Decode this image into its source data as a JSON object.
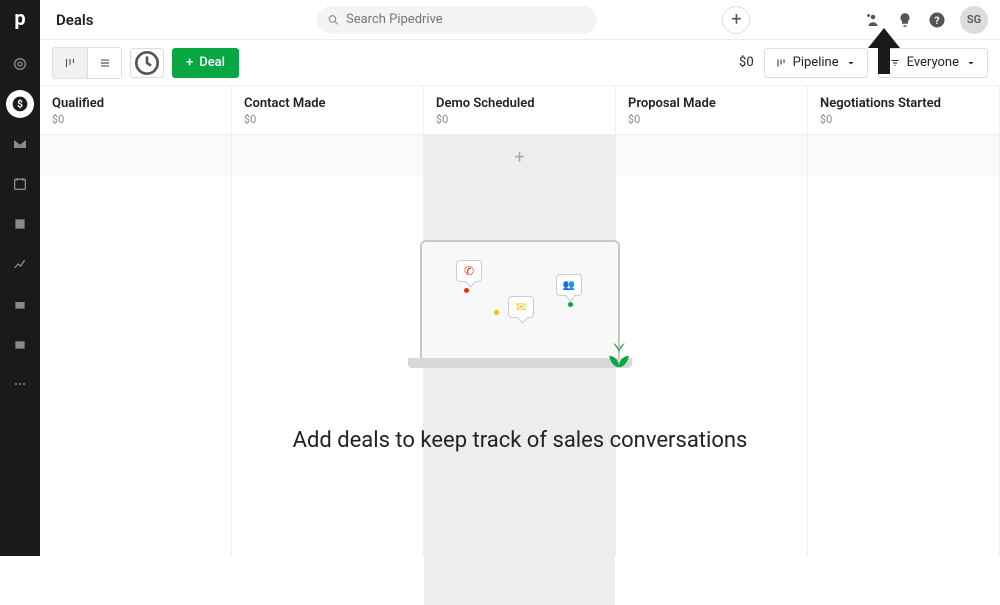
{
  "header": {
    "page_title": "Deals",
    "search_placeholder": "Search Pipedrive",
    "avatar_initials": "SG"
  },
  "toolbar": {
    "deal_button": "Deal",
    "total": "$0",
    "pipeline_label": "Pipeline",
    "everyone_label": "Everyone"
  },
  "stages": [
    {
      "name": "Qualified",
      "amount": "$0"
    },
    {
      "name": "Contact Made",
      "amount": "$0"
    },
    {
      "name": "Demo Scheduled",
      "amount": "$0"
    },
    {
      "name": "Proposal Made",
      "amount": "$0"
    },
    {
      "name": "Negotiations Started",
      "amount": "$0"
    }
  ],
  "empty_state": {
    "title": "Add deals to keep track of sales conversations"
  },
  "icons": {
    "phone": "phone-icon",
    "mail": "mail-icon",
    "people": "people-icon"
  }
}
